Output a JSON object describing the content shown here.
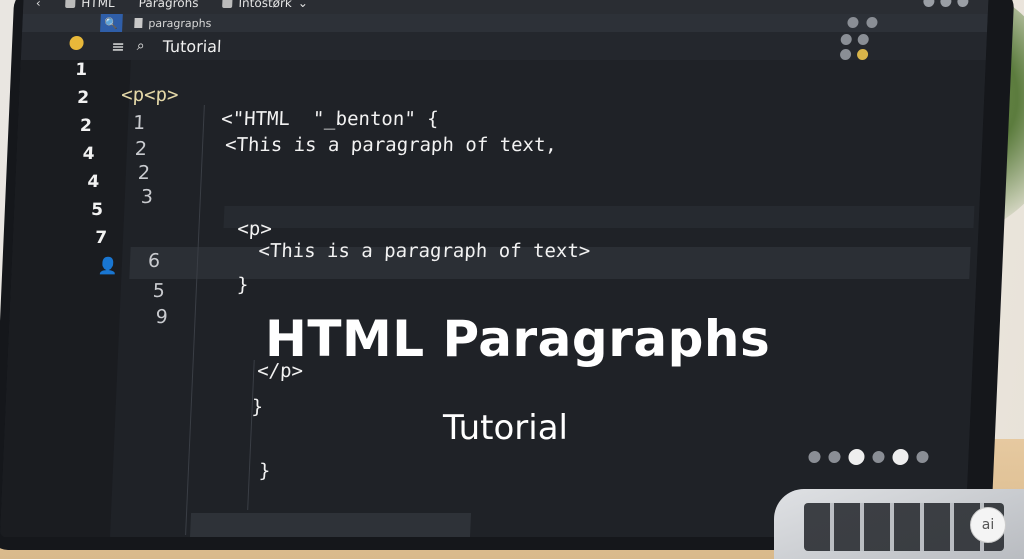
{
  "tabbar": {
    "back_glyph": "‹",
    "tabs": [
      {
        "label": "HTML"
      },
      {
        "label": "Paragrohs"
      },
      {
        "label": "Intostørk"
      }
    ],
    "chevron_glyph": "⌄"
  },
  "address": {
    "search_glyph": "🔍",
    "file_label": "paragraphs"
  },
  "toolbar": {
    "menu_glyph": "≡",
    "search_glyph": "⌕",
    "title": "Tutorial"
  },
  "gutter": {
    "left_numbers": [
      "1",
      "2",
      "2",
      "4",
      "4",
      "5",
      "7"
    ],
    "inner_numbers": [
      "1",
      "2",
      "2",
      "3",
      "6",
      "5",
      "9"
    ]
  },
  "code": {
    "line_pp": "<p<p>",
    "line_a": "<\"HTML  \"_benton\" {",
    "line_b": "<This is a paragraph of text,",
    "line_c": "<p>",
    "line_d": "<This is a paragraph of text>",
    "line_e": "}",
    "line_f": "</p>",
    "line_g": "}",
    "line_h": "}"
  },
  "overlay": {
    "title": "HTML Paragraphs",
    "subtitle": "Tutorial"
  },
  "brand": {
    "logo_text": "ai"
  },
  "colors": {
    "accent": "#2f5ea8",
    "status_dot": "#e8b83a",
    "editor_bg": "#1f2227"
  }
}
